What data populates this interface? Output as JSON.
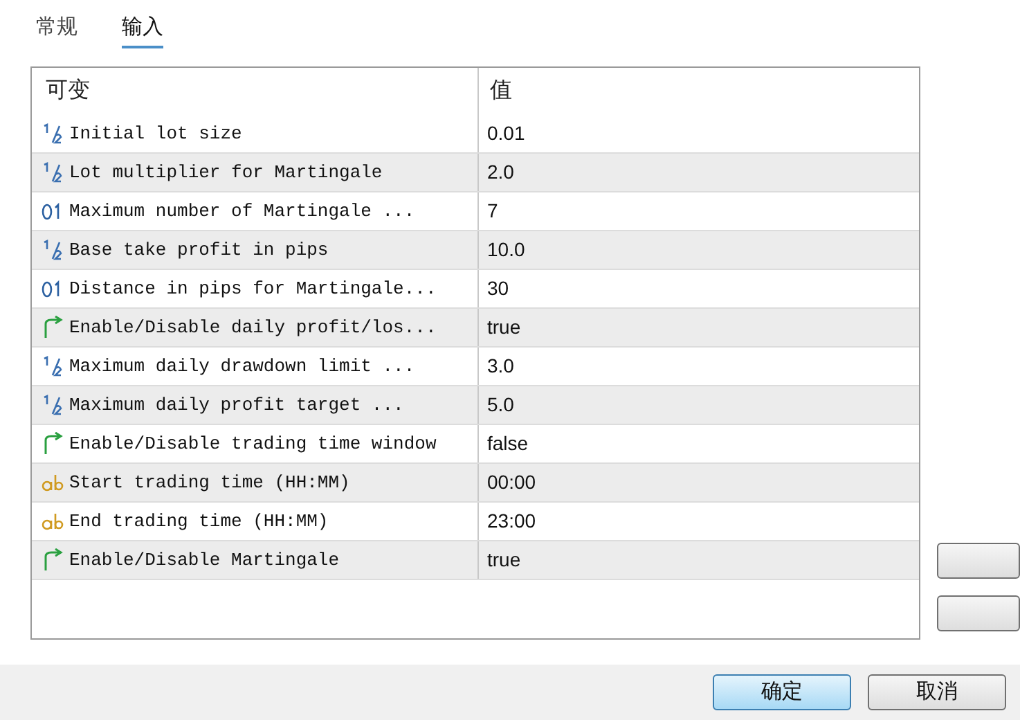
{
  "tabs": [
    {
      "label": "常规",
      "selected": false
    },
    {
      "label": "输入",
      "selected": true
    }
  ],
  "table": {
    "columns": [
      "可变",
      "值"
    ],
    "rows": [
      {
        "kind": "double",
        "name": "Initial lot size",
        "value": "0.01"
      },
      {
        "kind": "double",
        "name": "Lot multiplier for Martingale",
        "value": "2.0"
      },
      {
        "kind": "int",
        "name": "Maximum number of Martingale ...",
        "value": "7"
      },
      {
        "kind": "double",
        "name": "Base take profit in pips",
        "value": "10.0"
      },
      {
        "kind": "int",
        "name": "Distance in pips for Martingale...",
        "value": "30"
      },
      {
        "kind": "bool",
        "name": "Enable/Disable daily profit/los...",
        "value": "true"
      },
      {
        "kind": "double",
        "name": "Maximum daily drawdown limit ...",
        "value": "3.0"
      },
      {
        "kind": "double",
        "name": "Maximum daily profit target ...",
        "value": "5.0"
      },
      {
        "kind": "bool",
        "name": "Enable/Disable trading time window",
        "value": "false"
      },
      {
        "kind": "string",
        "name": "Start trading time (HH:MM)",
        "value": "00:00"
      },
      {
        "kind": "string",
        "name": "End trading time (HH:MM)",
        "value": "23:00"
      },
      {
        "kind": "bool",
        "name": "Enable/Disable Martingale",
        "value": "true"
      }
    ]
  },
  "buttons": [
    {
      "label": "确定",
      "selected": true
    },
    {
      "label": "取消",
      "selected": false
    }
  ]
}
